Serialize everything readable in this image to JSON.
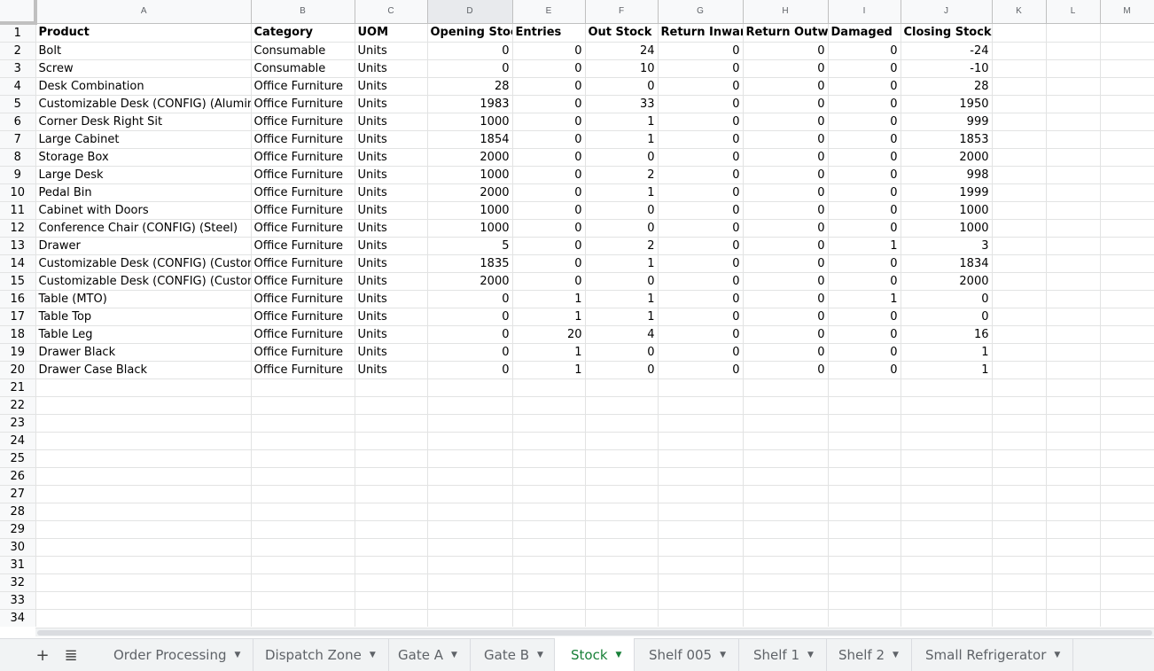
{
  "columns": [
    "A",
    "B",
    "C",
    "D",
    "E",
    "F",
    "G",
    "H",
    "I",
    "J",
    "K",
    "L",
    "M"
  ],
  "rows": [
    [
      "Product",
      "Category",
      "UOM",
      "Opening Stock",
      "Entries",
      "Out Stock",
      "Return Inwards",
      "Return Outwards",
      "Damaged",
      "Closing Stock",
      "",
      "",
      ""
    ],
    [
      "Bolt",
      "Consumable",
      "Units",
      "0",
      "0",
      "24",
      "0",
      "0",
      "0",
      "-24",
      "",
      "",
      ""
    ],
    [
      "Screw",
      "Consumable",
      "Units",
      "0",
      "0",
      "10",
      "0",
      "0",
      "0",
      "-10",
      "",
      "",
      ""
    ],
    [
      "Desk Combination",
      "Office Furniture",
      "Units",
      "28",
      "0",
      "0",
      "0",
      "0",
      "0",
      "28",
      "",
      "",
      ""
    ],
    [
      "Customizable Desk (CONFIG) (Aluminium, White)",
      "Office Furniture",
      "Units",
      "1983",
      "0",
      "33",
      "0",
      "0",
      "0",
      "1950",
      "",
      "",
      ""
    ],
    [
      "Corner Desk Right Sit",
      "Office Furniture",
      "Units",
      "1000",
      "0",
      "1",
      "0",
      "0",
      "0",
      "999",
      "",
      "",
      ""
    ],
    [
      "Large Cabinet",
      "Office Furniture",
      "Units",
      "1854",
      "0",
      "1",
      "0",
      "0",
      "0",
      "1853",
      "",
      "",
      ""
    ],
    [
      "Storage Box",
      "Office Furniture",
      "Units",
      "2000",
      "0",
      "0",
      "0",
      "0",
      "0",
      "2000",
      "",
      "",
      ""
    ],
    [
      "Large Desk",
      "Office Furniture",
      "Units",
      "1000",
      "0",
      "2",
      "0",
      "0",
      "0",
      "998",
      "",
      "",
      ""
    ],
    [
      "Pedal Bin",
      "Office Furniture",
      "Units",
      "2000",
      "0",
      "1",
      "0",
      "0",
      "0",
      "1999",
      "",
      "",
      ""
    ],
    [
      "Cabinet with Doors",
      "Office Furniture",
      "Units",
      "1000",
      "0",
      "0",
      "0",
      "0",
      "0",
      "1000",
      "",
      "",
      ""
    ],
    [
      "Conference Chair (CONFIG) (Steel)",
      "Office Furniture",
      "Units",
      "1000",
      "0",
      "0",
      "0",
      "0",
      "0",
      "1000",
      "",
      "",
      ""
    ],
    [
      "Drawer",
      "Office Furniture",
      "Units",
      "5",
      "0",
      "2",
      "0",
      "0",
      "1",
      "3",
      "",
      "",
      ""
    ],
    [
      "Customizable Desk (CONFIG) (Custom, White)",
      "Office Furniture",
      "Units",
      "1835",
      "0",
      "1",
      "0",
      "0",
      "0",
      "1834",
      "",
      "",
      ""
    ],
    [
      "Customizable Desk (CONFIG) (Custom, Black)",
      "Office Furniture",
      "Units",
      "2000",
      "0",
      "0",
      "0",
      "0",
      "0",
      "2000",
      "",
      "",
      ""
    ],
    [
      "Table (MTO)",
      "Office Furniture",
      "Units",
      "0",
      "1",
      "1",
      "0",
      "0",
      "1",
      "0",
      "",
      "",
      ""
    ],
    [
      "Table Top",
      "Office Furniture",
      "Units",
      "0",
      "1",
      "1",
      "0",
      "0",
      "0",
      "0",
      "",
      "",
      ""
    ],
    [
      "Table Leg",
      "Office Furniture",
      "Units",
      "0",
      "20",
      "4",
      "0",
      "0",
      "0",
      "16",
      "",
      "",
      ""
    ],
    [
      "Drawer Black",
      "Office Furniture",
      "Units",
      "0",
      "1",
      "0",
      "0",
      "0",
      "0",
      "1",
      "",
      "",
      ""
    ],
    [
      "Drawer Case Black",
      "Office Furniture",
      "Units",
      "0",
      "1",
      "0",
      "0",
      "0",
      "0",
      "1",
      "",
      "",
      ""
    ]
  ],
  "empty_row_numbers": [
    "21",
    "22",
    "23",
    "24",
    "25",
    "26",
    "27",
    "28",
    "29",
    "30",
    "31",
    "32",
    "33",
    "34"
  ],
  "selected_column": "D",
  "sheet_tabs": [
    "Order Processing",
    "Dispatch Zone",
    "Gate A",
    "Gate B",
    "Stock",
    "Shelf 005",
    "Shelf 1",
    "Shelf 2",
    "Small Refrigerator"
  ],
  "active_tab": "Stock",
  "toolbar": {
    "add_sheet_icon": "plus-icon",
    "all_sheets_icon": "list-icon"
  },
  "colors": {
    "active_tab": "#188038",
    "header_bg": "#f8f9fa",
    "grid_line": "#e2e3e3"
  }
}
